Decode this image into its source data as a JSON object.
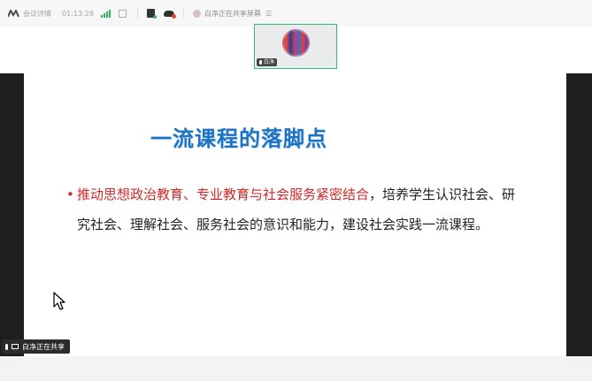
{
  "topbar": {
    "meeting_info_label": "会议详情",
    "timer": "01:13:28",
    "sharing_status": "白净正在共享屏幕",
    "menu_icon": "menu-icon"
  },
  "video": {
    "participant_name": "白净"
  },
  "slide": {
    "title": "一流课程的落脚点",
    "bullet": "•",
    "emphasis_text": "推动思想政治教育、专业教育与社会服务紧密结合",
    "line1_rest": "，培养学生认识社会、研",
    "line2": "究社会、理解社会、服务社会的意识和能力，建设社会实践一流课程。"
  },
  "status": {
    "sharing_badge": "白净正在共享"
  },
  "colors": {
    "title_blue": "#1c73c5",
    "emphasis_red": "#d12828",
    "active_green": "#2fbf6e"
  }
}
